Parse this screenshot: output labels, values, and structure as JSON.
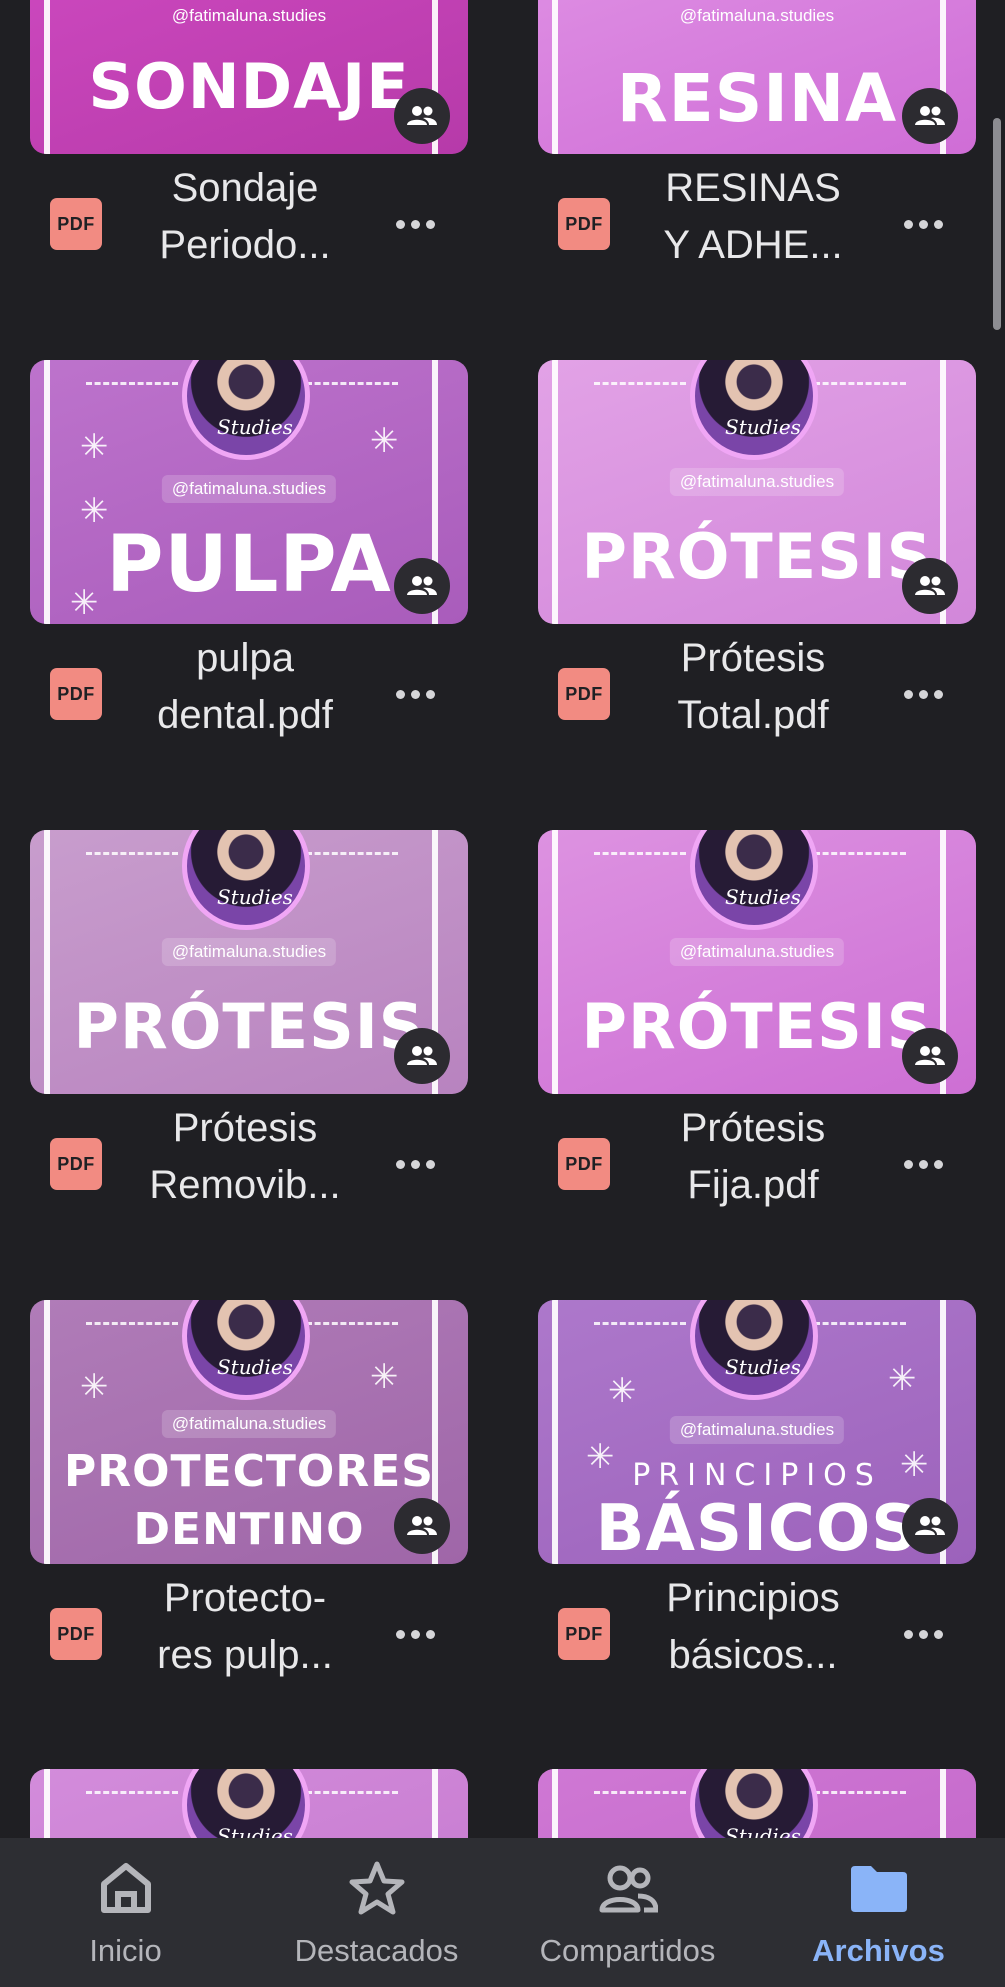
{
  "colors": {
    "background": "#1f1f23",
    "nav_background": "#2d2e33",
    "pdf_badge": "#f28b82",
    "active_tab": "#8ab4f8",
    "inactive_tab": "#b4b5ba"
  },
  "files": [
    {
      "name_line1": "Sondaje",
      "name_line2": "Periodo...",
      "type_badge": "PDF",
      "thumb_title": "SONDAJE",
      "thumb_handle": "@fatimaluna.studies",
      "thumb_color": "#c744b8",
      "shared": true
    },
    {
      "name_line1": "RESINAS",
      "name_line2": "Y ADHE...",
      "type_badge": "PDF",
      "thumb_title": "RESINA",
      "thumb_handle": "@fatimaluna.studies",
      "thumb_color": "#d780dd",
      "shared": true
    },
    {
      "name_line1": "pulpa",
      "name_line2": "dental.pdf",
      "type_badge": "PDF",
      "thumb_title": "PULPA",
      "thumb_handle": "@fatimaluna.studies",
      "thumb_avatar_text": "Studies",
      "thumb_color": "#b466c4",
      "shared": true
    },
    {
      "name_line1": "Prótesis",
      "name_line2": "Total.pdf",
      "type_badge": "PDF",
      "thumb_title": "PRÓTESIS",
      "thumb_handle": "@fatimaluna.studies",
      "thumb_avatar_text": "Studies",
      "thumb_color": "#d995e0",
      "shared": true
    },
    {
      "name_line1": "Prótesis",
      "name_line2": "Removib...",
      "type_badge": "PDF",
      "thumb_title": "PRÓTESIS",
      "thumb_handle": "@fatimaluna.studies",
      "thumb_avatar_text": "Studies",
      "thumb_color": "#be8fc4",
      "shared": true
    },
    {
      "name_line1": "Prótesis",
      "name_line2": "Fija.pdf",
      "type_badge": "PDF",
      "thumb_title": "PRÓTESIS",
      "thumb_handle": "@fatimaluna.studies",
      "thumb_avatar_text": "Studies",
      "thumb_color": "#d27bd7",
      "shared": true
    },
    {
      "name_line1": "Protecto-",
      "name_line2": "res pulp...",
      "type_badge": "PDF",
      "thumb_title": "PROTECTORES",
      "thumb_title2": "DENTINO",
      "thumb_handle": "@fatimaluna.studies",
      "thumb_avatar_text": "Studies",
      "thumb_color": "#a970b0",
      "shared": true
    },
    {
      "name_line1": "Principios",
      "name_line2": "básicos...",
      "type_badge": "PDF",
      "thumb_title": "BÁSICOS",
      "thumb_subtitle": "PRINCIPIOS",
      "thumb_handle": "@fatimaluna.studies",
      "thumb_avatar_text": "Studies",
      "thumb_color": "#a66fc3",
      "shared": true
    },
    {
      "thumb_color": "#c97fd4",
      "thumb_avatar_text": "Studies"
    },
    {
      "thumb_color": "#c46dc9",
      "thumb_avatar_text": "Studies"
    }
  ],
  "bottom_nav": [
    {
      "label": "Inicio",
      "icon": "home-icon",
      "active": false
    },
    {
      "label": "Destacados",
      "icon": "star-icon",
      "active": false
    },
    {
      "label": "Compartidos",
      "icon": "people-icon",
      "active": false
    },
    {
      "label": "Archivos",
      "icon": "folder-icon",
      "active": true
    }
  ]
}
